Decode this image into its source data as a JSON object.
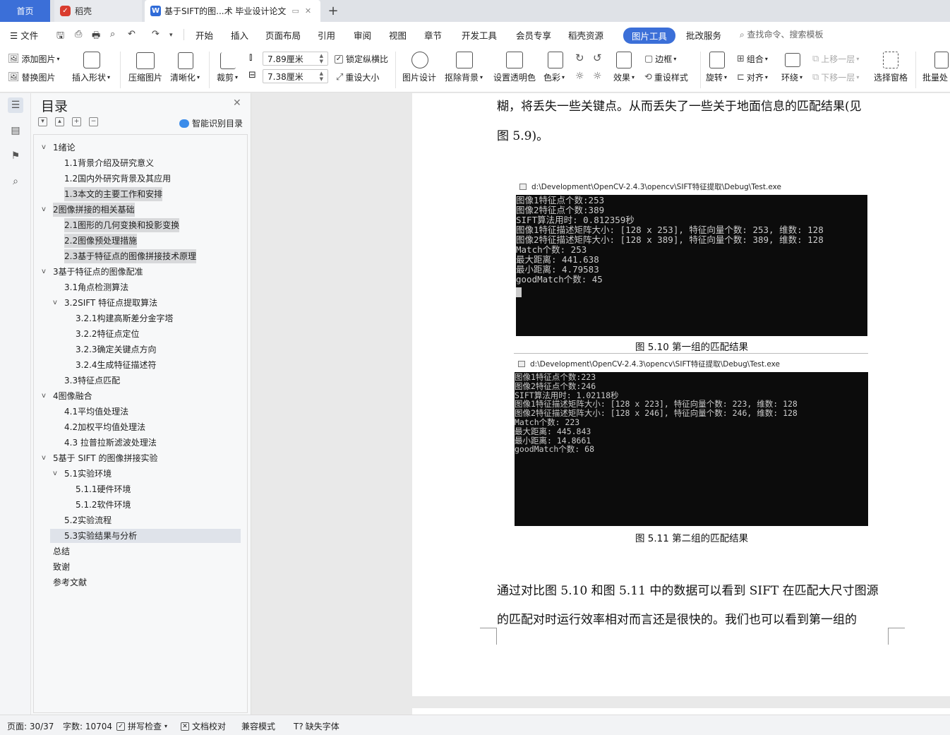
{
  "tabs": {
    "home": "首页",
    "daoke": "稻壳",
    "doc": "基于SIFT的图...术 毕业设计论文",
    "new_tab": "+"
  },
  "menu": {
    "file": "文件",
    "items": [
      "开始",
      "插入",
      "页面布局",
      "引用",
      "审阅",
      "视图",
      "章节",
      "开发工具",
      "会员专享",
      "稻壳资源",
      "图片工具",
      "批改服务"
    ],
    "active": "图片工具",
    "search_placeholder": "查找命令、搜索模板"
  },
  "ribbon": {
    "add_image": "添加图片",
    "replace_image": "替换图片",
    "insert_shape": "插入形状",
    "compress": "压缩图片",
    "sharpen": "清晰化",
    "crop": "裁剪",
    "width": "7.89厘米",
    "height": "7.38厘米",
    "lock_ratio": "锁定纵横比",
    "reset_size": "重设大小",
    "design": "图片设计",
    "remove_bg": "抠除背景",
    "transparent": "设置透明色",
    "color": "色彩",
    "effects": "效果",
    "border": "边框",
    "reset_style": "重设样式",
    "rotate": "旋转",
    "group": "组合",
    "align": "对齐",
    "wrap": "环绕",
    "bring_forward": "上移一层",
    "send_backward": "下移一层",
    "select_pane": "选择窗格",
    "batch": "批量处"
  },
  "toc": {
    "title": "目录",
    "smart": "智能识别目录",
    "items": [
      {
        "text": "1绪论",
        "level": 1,
        "caret": "v"
      },
      {
        "text": "1.1背景介绍及研究意义",
        "level": 2
      },
      {
        "text": "1.2国内外研究背景及其应用",
        "level": 2
      },
      {
        "text": "1.3本文的主要工作和安排",
        "level": 2
      },
      {
        "text": "2图像拼接的相关基础",
        "level": 1,
        "caret": "v"
      },
      {
        "text": "2.1图形的几何变换和投影变换",
        "level": 2
      },
      {
        "text": "2.2图像预处理措施",
        "level": 2
      },
      {
        "text": "2.3基于特征点的图像拼接技术原理",
        "level": 2
      },
      {
        "text": "3基于特征点的图像配准",
        "level": 1,
        "caret": "v"
      },
      {
        "text": "3.1角点检测算法",
        "level": 2
      },
      {
        "text": "3.2SIFT 特征点提取算法",
        "level": 2,
        "caret": "v"
      },
      {
        "text": "3.2.1构建高斯差分金字塔",
        "level": 3
      },
      {
        "text": "3.2.2特征点定位",
        "level": 3
      },
      {
        "text": "3.2.3确定关键点方向",
        "level": 3
      },
      {
        "text": "3.2.4生成特征描述符",
        "level": 3
      },
      {
        "text": "3.3特征点匹配",
        "level": 2
      },
      {
        "text": "4图像融合",
        "level": 1,
        "caret": "v"
      },
      {
        "text": "4.1平均值处理法",
        "level": 2
      },
      {
        "text": "4.2加权平均值处理法",
        "level": 2
      },
      {
        "text": "4.3 拉普拉斯滤波处理法",
        "level": 2
      },
      {
        "text": "5基于 SIFT 的图像拼接实验",
        "level": 1,
        "caret": "v"
      },
      {
        "text": "5.1实验环境",
        "level": 2,
        "caret": "v"
      },
      {
        "text": "5.1.1硬件环境",
        "level": 3
      },
      {
        "text": "5.1.2软件环境",
        "level": 3
      },
      {
        "text": "5.2实验流程",
        "level": 2
      },
      {
        "text": "5.3实验结果与分析",
        "level": 2
      },
      {
        "text": "总结",
        "level": 1
      },
      {
        "text": "致谢",
        "level": 1
      },
      {
        "text": "参考文献",
        "level": 1
      }
    ]
  },
  "doc": {
    "line1": "糊，将丢失一些关键点。从而丢失了一些关于地面信息的匹配结果(见",
    "line2": "图 5.9)。",
    "console1": {
      "title": "d:\\Development\\OpenCV-2.4.3\\opencv\\SIFT特征提取\\Debug\\Test.exe",
      "lines": [
        "图像1特征点个数:253",
        "图像2特征点个数:389",
        "SIFT算法用时: 0.812359秒",
        "图像1特征描述矩阵大小: [128 x 253], 特征向量个数: 253, 维数: 128",
        "图像2特征描述矩阵大小: [128 x 389], 特征向量个数: 389, 维数: 128",
        "Match个数: 253",
        "最大距离: 441.638",
        "最小距离: 4.79583",
        "goodMatch个数: 45"
      ]
    },
    "caption1": "图 5.10 第一组的匹配结果",
    "console2": {
      "title": "d:\\Development\\OpenCV-2.4.3\\opencv\\SIFT特征提取\\Debug\\Test.exe",
      "lines": [
        "图像1特征点个数:223",
        "图像2特征点个数:246",
        "SIFT算法用时: 1.02118秒",
        "图像1特征描述矩阵大小: [128 x 223], 特征向量个数: 223, 维数: 128",
        "图像2特征描述矩阵大小: [128 x 246], 特征向量个数: 246, 维数: 128",
        "Match个数: 223",
        "最大距离: 445.843",
        "最小距离: 14.8661",
        "goodMatch个数: 68"
      ]
    },
    "caption2": "图 5.11 第二组的匹配结果",
    "para1": "通过对比图 5.10 和图 5.11 中的数据可以看到 SIFT 在匹配大尺寸图源",
    "para2": "的匹配对时运行效率相对而言还是很快的。我们也可以看到第一组的"
  },
  "status": {
    "page": "页面: 30/37",
    "words": "字数: 10704",
    "spell": "拼写检查",
    "proof": "文档校对",
    "compat": "兼容模式",
    "missing_font": "缺失字体"
  },
  "colors": {
    "accent": "#3b6fd8",
    "console_bg": "#0c0c0c"
  }
}
